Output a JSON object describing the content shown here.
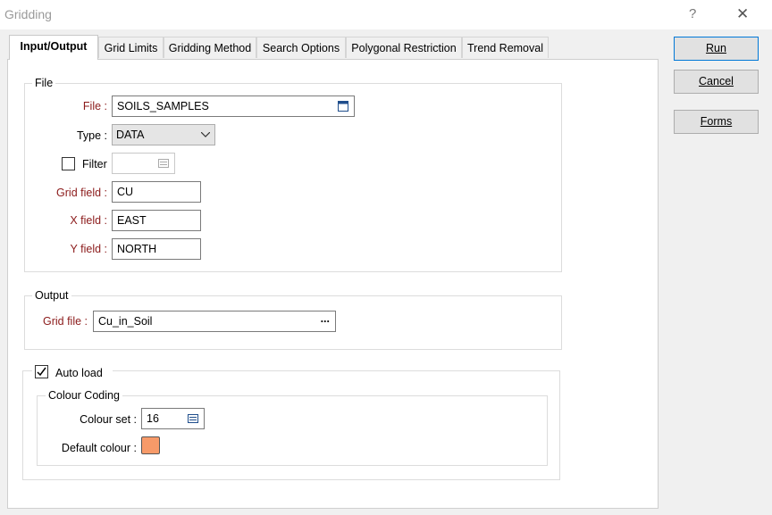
{
  "window": {
    "title": "Gridding",
    "help_glyph": "?",
    "close_glyph": "✕"
  },
  "tabs": [
    {
      "label": "Input/Output"
    },
    {
      "label": "Grid Limits"
    },
    {
      "label": "Gridding Method"
    },
    {
      "label": "Search Options"
    },
    {
      "label": "Polygonal Restriction"
    },
    {
      "label": "Trend Removal"
    }
  ],
  "buttons": {
    "run": "Run",
    "cancel": "Cancel",
    "forms": "Forms"
  },
  "file_group": {
    "label": "File",
    "file_label": "File :",
    "file_value": "SOILS_SAMPLES",
    "type_label": "Type :",
    "type_value": "DATA",
    "filter_label": "Filter",
    "filter_value": "",
    "grid_field_label": "Grid field :",
    "grid_field_value": "CU",
    "x_field_label": "X field :",
    "x_field_value": "EAST",
    "y_field_label": "Y field :",
    "y_field_value": "NORTH"
  },
  "output_group": {
    "label": "Output",
    "grid_file_label": "Grid file :",
    "grid_file_value": "Cu_in_Soil",
    "browse_glyph": "..."
  },
  "autoload": {
    "label": "Auto load",
    "checked": true,
    "colour_coding_label": "Colour Coding",
    "colour_set_label": "Colour set :",
    "colour_set_value": "16",
    "default_colour_label": "Default colour :",
    "default_colour": "#f79a69"
  },
  "colors": {
    "required_label": "#8b1a1a",
    "accent": "#0078d7"
  }
}
